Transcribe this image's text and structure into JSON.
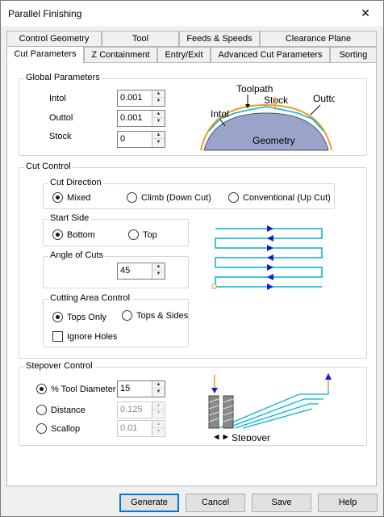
{
  "window": {
    "title": "Parallel Finishing",
    "close_glyph": "✕"
  },
  "tabs_row1": [
    "Control Geometry",
    "Tool",
    "Feeds & Speeds",
    "Clearance Plane"
  ],
  "tabs_row2": [
    "Cut Parameters",
    "Z Containment",
    "Entry/Exit",
    "Advanced Cut Parameters",
    "Sorting"
  ],
  "active_tab": "Cut Parameters",
  "global": {
    "title": "Global Parameters",
    "intol_label": "Intol",
    "intol_value": "0.001",
    "outtol_label": "Outtol",
    "outtol_value": "0.001",
    "stock_label": "Stock",
    "stock_value": "0",
    "diagram": {
      "toolpath": "Toolpath",
      "stock": "Stock",
      "outtol": "Outtol",
      "intol": "Intol",
      "geometry": "Geometry"
    }
  },
  "cut_control": {
    "title": "Cut Control",
    "direction": {
      "title": "Cut Direction",
      "options": [
        "Mixed",
        "Climb (Down Cut)",
        "Conventional (Up Cut)"
      ],
      "selected": "Mixed"
    },
    "start_side": {
      "title": "Start Side",
      "options": [
        "Bottom",
        "Top"
      ],
      "selected": "Bottom"
    },
    "angle": {
      "title": "Angle of Cuts",
      "value": "45"
    },
    "area": {
      "title": "Cutting Area Control",
      "options": [
        "Tops Only",
        "Tops & Sides"
      ],
      "selected": "Tops Only",
      "ignore_holes": "Ignore Holes",
      "ignore_holes_checked": false
    }
  },
  "stepover": {
    "title": "Stepover Control",
    "tool_diameter_label": "% Tool Diameter",
    "tool_diameter_value": "15",
    "distance_label": "Distance",
    "distance_value": "0.125",
    "scallop_label": "Scallop",
    "scallop_value": "0.01",
    "selected": "% Tool Diameter",
    "diagram_label": "Stepover"
  },
  "buttons": {
    "generate": "Generate",
    "cancel": "Cancel",
    "save": "Save",
    "help": "Help"
  },
  "colors": {
    "accent": "#0078d7",
    "path_cyan": "#00b4d8",
    "marker_blue": "#1a1ad0",
    "orange": "#f39a1e",
    "geometry_fill": "#9aa4c8"
  }
}
